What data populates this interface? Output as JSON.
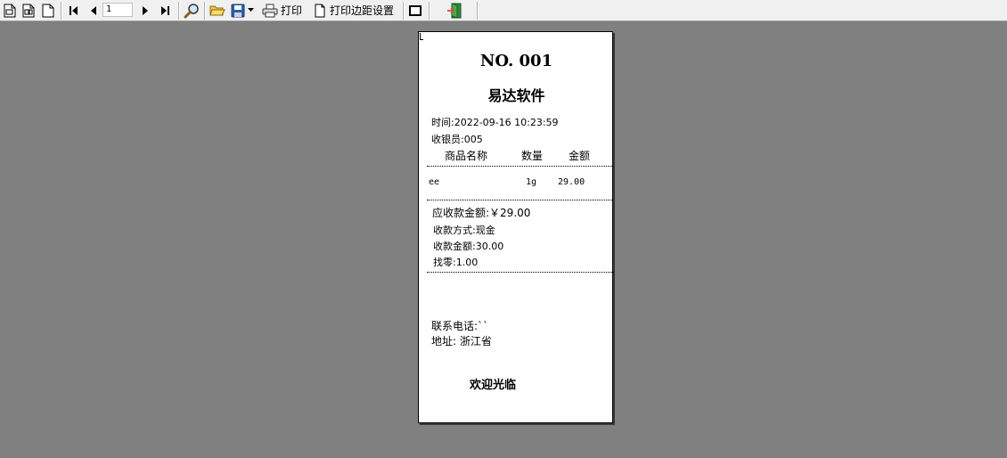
{
  "toolbar": {
    "page_number": "1",
    "print_label": "打印",
    "margin_label": "打印边距设置"
  },
  "receipt": {
    "number": "NO. 001",
    "company": "易达软件",
    "time": "时间:2022-09-16 10:23:59",
    "cashier": "收银员:005",
    "headers": {
      "name": "商品名称",
      "qty": "数量",
      "amount": "金额"
    },
    "items": [
      {
        "name": "ee",
        "qty": "1g",
        "amount": "29.00"
      }
    ],
    "due": "应收款金额:￥29.00",
    "payment_method": "收款方式:现金",
    "paid": "收款金额:30.00",
    "change": "找零:1.00",
    "phone": "联系电话:``",
    "address": "地址: 浙江省",
    "footer": "欢迎光临"
  },
  "colors": {
    "background": "#808080",
    "toolbar": "#f0f0f0",
    "paper": "#ffffff"
  },
  "icons": [
    "first-page-icon",
    "single-page-icon",
    "blank-page-icon",
    "nav-first-icon",
    "nav-prev-icon",
    "nav-next-icon",
    "nav-last-icon",
    "zoom-icon",
    "open-folder-icon",
    "save-icon",
    "dropdown-arrow-icon",
    "printer-icon",
    "page-icon",
    "frame-icon",
    "exit-icon"
  ]
}
